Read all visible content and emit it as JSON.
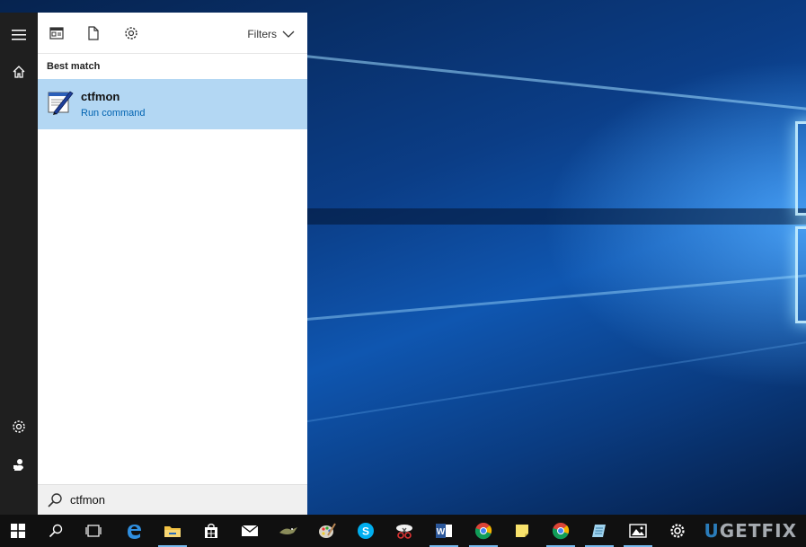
{
  "start_menu": {
    "rail": {
      "hamburger": "menu-icon",
      "home": "home-icon",
      "settings": "gear-icon",
      "user": "user-icon"
    },
    "toolbar": {
      "apps_icon": "apps-icon",
      "documents_icon": "document-icon",
      "settings_icon": "gear-icon",
      "filters_label": "Filters"
    },
    "section_label": "Best match",
    "best_match": {
      "title": "ctfmon",
      "subtitle": "Run command",
      "icon": "run-command-icon"
    },
    "search": {
      "value": "ctfmon"
    }
  },
  "taskbar": {
    "items": [
      "windows-start-icon",
      "search-icon",
      "task-view-icon",
      "edge-icon",
      "file-explorer-icon",
      "store-icon",
      "mail-icon",
      "app-icon",
      "paint-icon",
      "skype-icon",
      "snipping-icon",
      "word-icon",
      "chrome-icon",
      "sticky-notes-icon",
      "chrome-icon",
      "notepad-icon",
      "photos-icon",
      "settings-icon"
    ]
  },
  "watermark": {
    "text_a": "U",
    "text_b": "GETFIX",
    "prefix": ""
  },
  "colors": {
    "accent": "#0063b1",
    "selection": "#b3d7f3",
    "rail": "#1f1f1f",
    "taskbar": "#101010"
  }
}
